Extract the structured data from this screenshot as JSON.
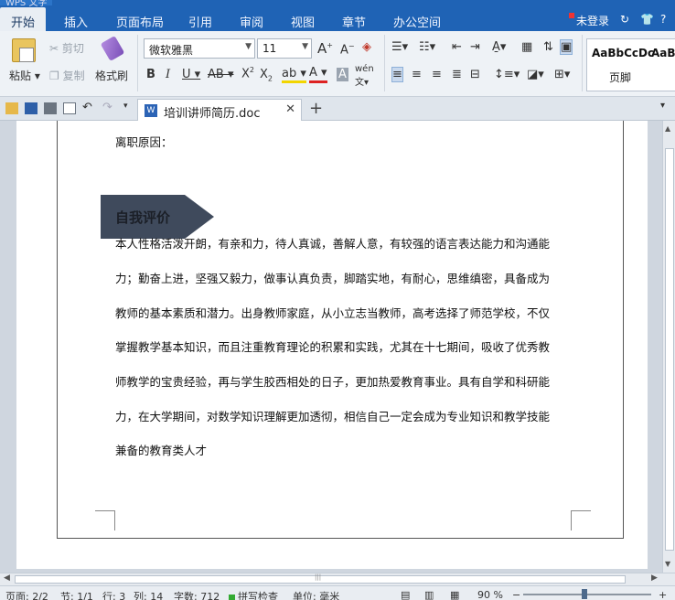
{
  "app": {
    "title_badge": "WPS 文字",
    "title_text": "培训讲师简历"
  },
  "menu": {
    "tabs": [
      "开始",
      "插入",
      "页面布局",
      "引用",
      "审阅",
      "视图",
      "章节",
      "办公空间"
    ],
    "login": "未登录",
    "help": "?"
  },
  "ribbon": {
    "paste": "粘贴",
    "cut": "剪切",
    "copy": "复制",
    "format_painter": "格式刷",
    "font_name": "微软雅黑",
    "font_size": "11",
    "style_samples": [
      "AaBbCcDc",
      "AaB"
    ],
    "style_caption": "页脚"
  },
  "doc_tab": {
    "filename": "培训讲师简历.doc"
  },
  "document": {
    "leave_reason": "离职原因：",
    "section_title": "自我评价",
    "lines": [
      "本人性格活泼开朗，有亲和力，待人真诚，善解人意，有较强的语言表达能力和沟通能",
      "力；勤奋上进，坚强又毅力，做事认真负责，脚踏实地，有耐心，思维缜密，具备成为",
      "教师的基本素质和潜力。出身教师家庭，从小立志当教师，高考选择了师范学校，不仅",
      "掌握教学基本知识，而且注重教育理论的积累和实践，尤其在十七期间，吸收了优秀教",
      "师教学的宝贵经验，再与学生胶西相处的日子，更加热爱教育事业。具有自学和科研能",
      "力，在大学期间，对数学知识理解更加透彻，相信自己一定会成为专业知识和教学技能",
      "兼备的教育类人才"
    ]
  },
  "status": {
    "page": "页面: 2/2",
    "section": "节: 1/1",
    "row": "行: 3",
    "col": "列: 14",
    "words": "字数: 712",
    "spell": "拼写检查",
    "unit": "单位: 毫米",
    "zoom": "90 %"
  },
  "colors": {
    "menubar": "#1f63b5",
    "banner": "#3f4a5c",
    "accent_green": "#33aa33"
  }
}
